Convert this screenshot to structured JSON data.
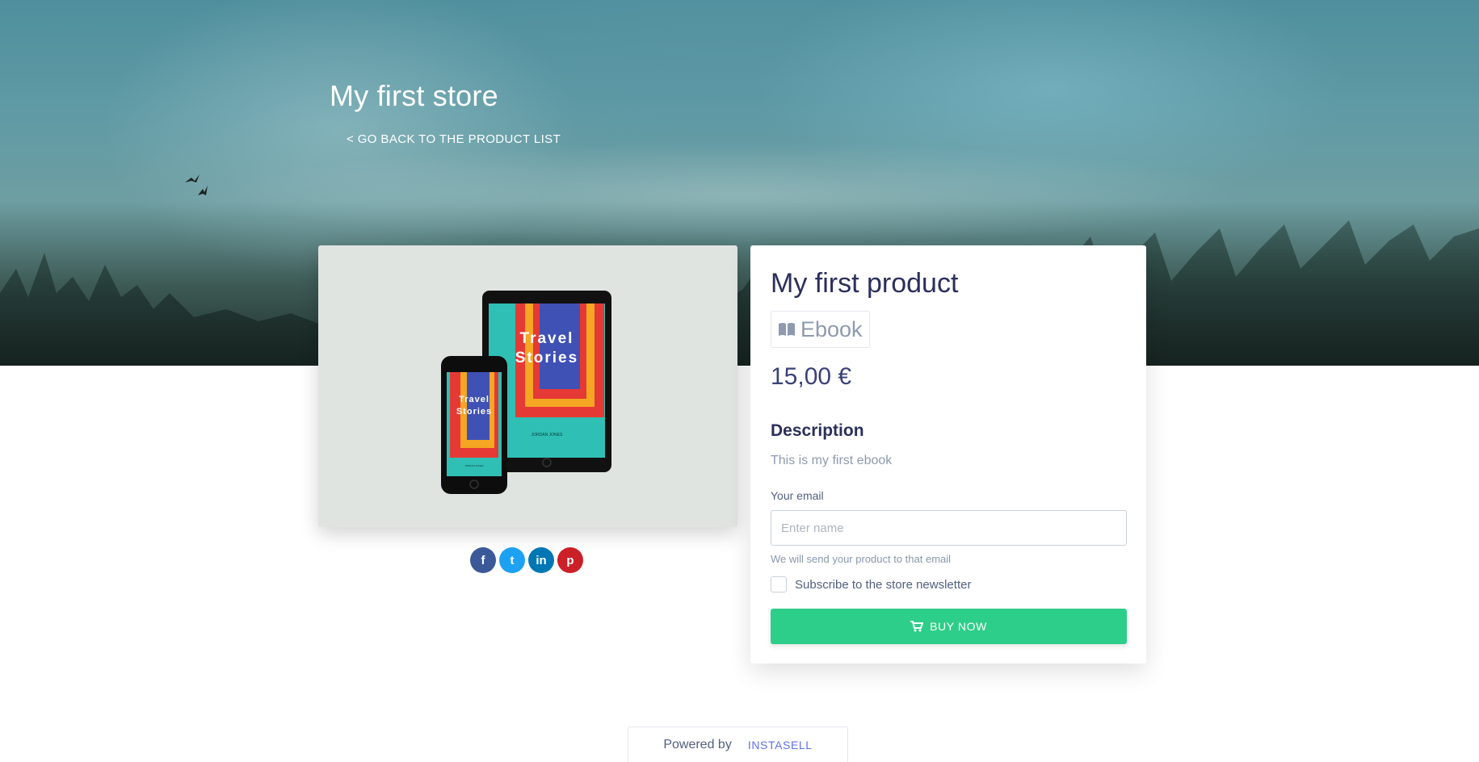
{
  "store": {
    "title": "My first store",
    "back_link": "< GO BACK TO THE PRODUCT LIST"
  },
  "product": {
    "title": "My first product",
    "type": "Ebook",
    "type_icon": "book-open-icon",
    "price": "15,00 €",
    "description_heading": "Description",
    "description": "This is my first ebook",
    "cover_title_line1": "Travel",
    "cover_title_line2": "Stories",
    "cover_author": "JORDAN JONES"
  },
  "share": {
    "buttons": [
      {
        "name": "facebook",
        "glyph": "f",
        "color": "#3b5998"
      },
      {
        "name": "twitter",
        "glyph": "t",
        "color": "#1da1f2"
      },
      {
        "name": "linkedin",
        "glyph": "in",
        "color": "#0077b5"
      },
      {
        "name": "pinterest",
        "glyph": "p",
        "color": "#cb2027"
      }
    ]
  },
  "form": {
    "email_label": "Your email",
    "email_placeholder": "Enter name",
    "email_value": "",
    "help_text": "We will send your product to that email",
    "newsletter_label": "Subscribe to the store newsletter",
    "newsletter_checked": false,
    "buy_label": "BUY NOW",
    "buy_icon": "cart-icon"
  },
  "footer": {
    "powered_by": "Powered by",
    "brand": "INSTASELL"
  },
  "colors": {
    "accent_green": "#2dce89",
    "brand_blue": "#5e72e4",
    "title_navy": "#2b2f5a"
  }
}
